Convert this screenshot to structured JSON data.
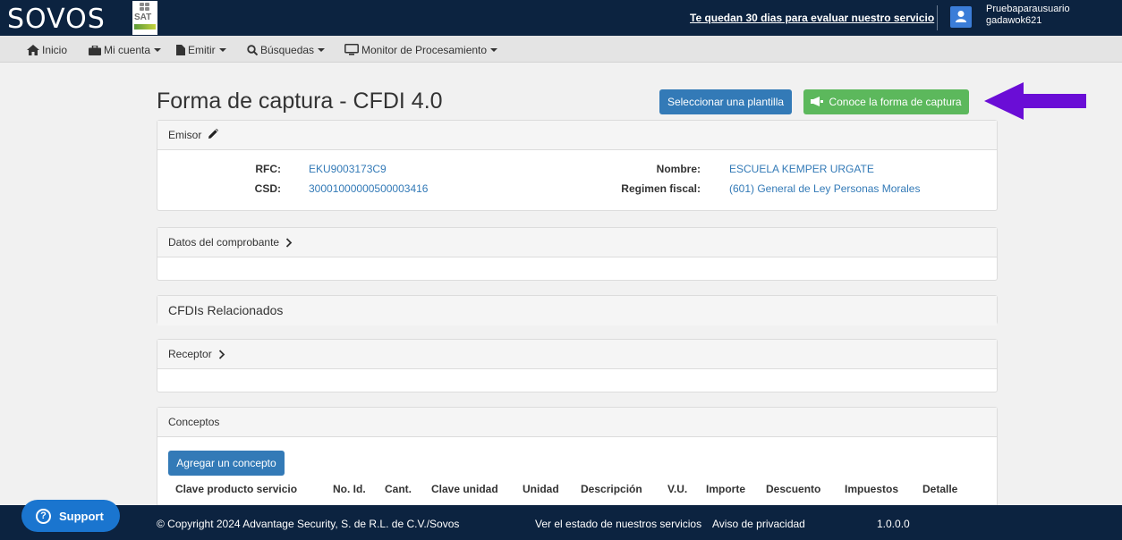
{
  "header": {
    "logo": "SOVOS",
    "sat_logo_text": "SAT",
    "trial_text": "Te quedan 30 dias para evaluar nuestro servicio",
    "user_line1": "Pruebaparausuario",
    "user_line2": "gadawok621"
  },
  "nav": {
    "items": [
      "Inicio",
      "Mi cuenta",
      "Emitir",
      "Búsquedas",
      "Monitor de Procesamiento"
    ]
  },
  "main": {
    "title": "Forma de captura - CFDI 4.0",
    "select_template_button": "Seleccionar una plantilla",
    "learn_button": "Conoce la forma de captura"
  },
  "emisor": {
    "heading": "Emisor",
    "rfc_label": "RFC:",
    "rfc_value": "EKU9003173C9",
    "csd_label": "CSD:",
    "csd_value": "30001000000500003416",
    "nombre_label": "Nombre:",
    "nombre_value": "ESCUELA KEMPER URGATE",
    "regimen_label": "Regimen fiscal:",
    "regimen_value": "(601) General de Ley Personas Morales"
  },
  "sections": {
    "comprobante": "Datos del comprobante",
    "relacionados": "CFDIs Relacionados",
    "receptor": "Receptor",
    "conceptos": "Conceptos"
  },
  "conceptos": {
    "add_button": "Agregar un concepto",
    "columns": [
      "Clave producto servicio",
      "No. Id.",
      "Cant.",
      "Clave unidad",
      "Unidad",
      "Descripción",
      "V.U.",
      "Importe",
      "Descuento",
      "Impuestos",
      "Detalle"
    ]
  },
  "footer": {
    "copyright": "© Copyright 2024 Advantage Security, S. de R.L. de C.V./Sovos",
    "status_link": "Ver el estado de nuestros servicios",
    "privacy_link": "Aviso de privacidad",
    "version": "1.0.0.0",
    "support": "Support"
  },
  "colors": {
    "header_bg": "#0c2340",
    "primary_blue": "#337ab7",
    "success_green": "#5cb85c",
    "arrow_purple": "#6a0dd6"
  }
}
